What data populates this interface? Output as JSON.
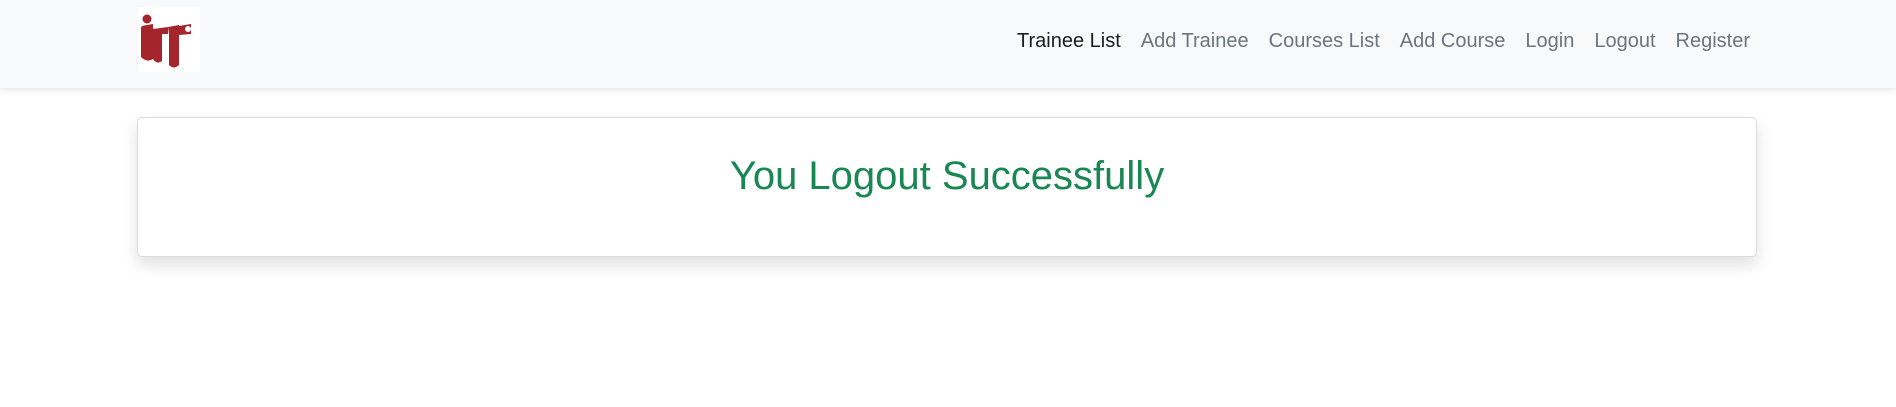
{
  "navbar": {
    "logo_alt": "ITI",
    "logo_color": "#a4262c",
    "links": [
      {
        "label": "Trainee List",
        "active": true
      },
      {
        "label": "Add Trainee",
        "active": false
      },
      {
        "label": "Courses List",
        "active": false
      },
      {
        "label": "Add Course",
        "active": false
      },
      {
        "label": "Login",
        "active": false
      },
      {
        "label": "Logout",
        "active": false
      },
      {
        "label": "Register",
        "active": false
      }
    ]
  },
  "main": {
    "message": "You Logout Successfully",
    "message_color": "#198754"
  }
}
